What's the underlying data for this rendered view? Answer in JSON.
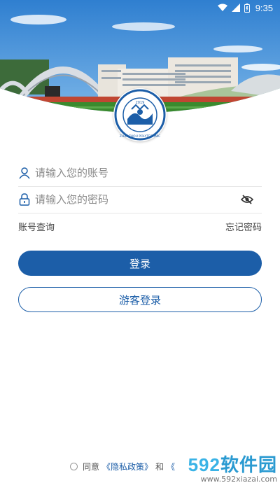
{
  "status_bar": {
    "time": "9:35",
    "icons": [
      "wifi-icon",
      "signal-icon",
      "battery-icon"
    ]
  },
  "hero": {
    "logo_ring_text": "ZHAOZHOU POLYTECHNIC",
    "logo_year": "2019"
  },
  "form": {
    "account_placeholder": "请输入您的账号",
    "password_placeholder": "请输入您的密码",
    "account_query": "账号查询",
    "forgot_password": "忘记密码",
    "login_button": "登录",
    "guest_login_button": "游客登录"
  },
  "agreement": {
    "prefix": "同意",
    "privacy_link": "《隐私政策》",
    "conjunction": "和",
    "other_link": "《"
  },
  "watermark": {
    "brand_num": "592",
    "brand_text": "软件园",
    "url": "www.592xiazai.com"
  },
  "colors": {
    "primary": "#1c5ea8",
    "sky": "#3f8fd8",
    "turf": "#3a8a2e"
  }
}
